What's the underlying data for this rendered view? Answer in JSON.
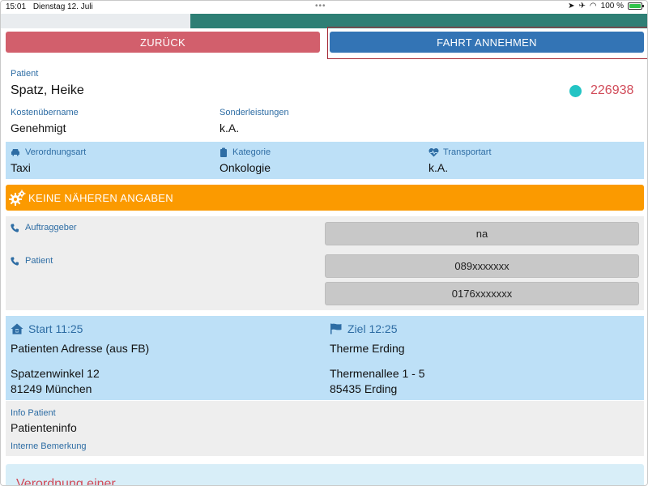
{
  "status": {
    "time": "15:01",
    "date": "Dienstag 12. Juli",
    "battery": "100 %"
  },
  "actions": {
    "back_label": "ZURÜCK",
    "accept_label": "FAHRT ANNEHMEN"
  },
  "patient": {
    "label": "Patient",
    "name": "Spatz, Heike",
    "id": "226938"
  },
  "cost": {
    "label": "Kostenübername",
    "value": "Genehmigt"
  },
  "special": {
    "label": "Sonderleistungen",
    "value": "k.A."
  },
  "order": {
    "prescription_label": "Verordnungsart",
    "prescription_value": "Taxi",
    "category_label": "Kategorie",
    "category_value": "Onkologie",
    "transport_label": "Transportart",
    "transport_value": "k.A."
  },
  "warning": {
    "text": "KEINE NÄHEREN ANGABEN"
  },
  "contacts": {
    "client_label": "Auftraggeber",
    "client_phone": "na",
    "patient_label": "Patient",
    "patient_phone_1": "089xxxxxxx",
    "patient_phone_2": "0176xxxxxxx"
  },
  "route": {
    "start_label": "Start 11:25",
    "start_name": "Patienten Adresse (aus FB)",
    "start_street": "Spatzenwinkel 12",
    "start_city": "81249 München",
    "dest_label": "Ziel 12:25",
    "dest_name": "Therme Erding",
    "dest_street": "Thermenallee 1 - 5",
    "dest_city": "85435 Erding"
  },
  "info": {
    "patient_info_label": "Info Patient",
    "patient_info_value": "Patienteninfo",
    "internal_label": "Interne Bemerkung"
  },
  "bottom": {
    "title": "Verordnung einer"
  },
  "colors": {
    "accent_blue": "#3374b5",
    "back_red": "#d25f6c",
    "warning_orange": "#fb9a00",
    "id_red": "#d14b59",
    "status_dot": "#23c4c4",
    "band_blue": "#bde0f7"
  }
}
